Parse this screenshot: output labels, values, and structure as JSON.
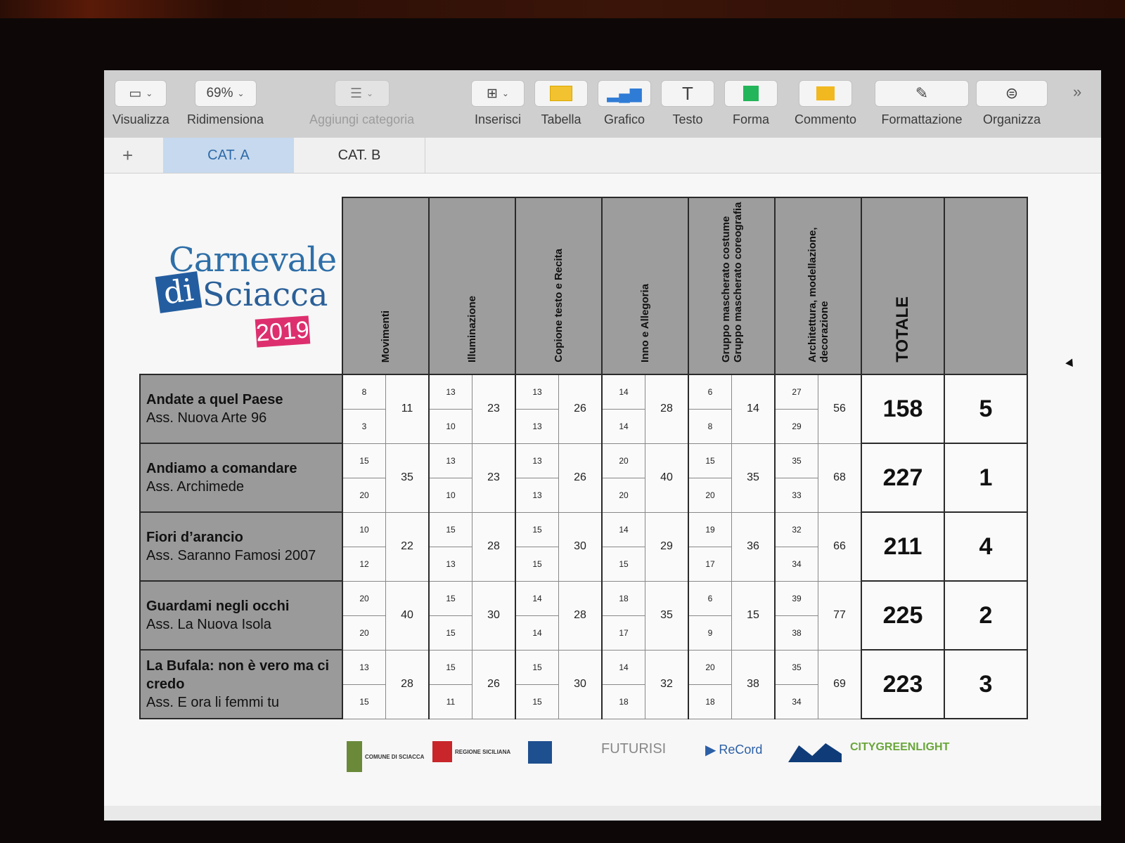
{
  "toolbar": {
    "items": [
      {
        "label": "Visualizza",
        "icon": "sidebar-icon"
      },
      {
        "label": "Ridimensiona",
        "value": "69%"
      },
      {
        "label": "Aggiungi categoria",
        "icon": "list-icon"
      },
      {
        "label": "Inserisci",
        "icon": "insert-icon"
      },
      {
        "label": "Tabella",
        "icon": "table-icon"
      },
      {
        "label": "Grafico",
        "icon": "chart-icon"
      },
      {
        "label": "Testo",
        "icon": "text-icon"
      },
      {
        "label": "Forma",
        "icon": "shape-icon"
      },
      {
        "label": "Commento",
        "icon": "comment-icon"
      },
      {
        "label": "Formattazione",
        "icon": "brush-icon"
      },
      {
        "label": "Organizza",
        "icon": "organize-icon"
      }
    ],
    "more": "»"
  },
  "tabs": {
    "add": "+",
    "items": [
      "CAT. A",
      "CAT. B"
    ]
  },
  "logo": {
    "line1": "Carnevale",
    "di": "di",
    "line2": "Sciacca",
    "year": "2019"
  },
  "table": {
    "headers": [
      "Movimenti",
      "Illuminazione",
      "Copione testo e Recita",
      "Inno e Allegoria",
      "Gruppo mascherato costume Gruppo mascherato coreografia",
      "Architettura, modellazione, decorazione",
      "TOTALE",
      ""
    ],
    "rows": [
      {
        "title": "Andate a quel Paese",
        "assoc": "Ass. Nuova Arte 96",
        "scores": [
          [
            "8",
            "3",
            "11"
          ],
          [
            "13",
            "10",
            "23"
          ],
          [
            "13",
            "13",
            "26"
          ],
          [
            "14",
            "14",
            "28"
          ],
          [
            "6",
            "8",
            "14"
          ],
          [
            "27",
            "29",
            "56"
          ]
        ],
        "total": "158",
        "rank": "5"
      },
      {
        "title": "Andiamo a comandare",
        "assoc": "Ass. Archimede",
        "scores": [
          [
            "15",
            "20",
            "35"
          ],
          [
            "13",
            "10",
            "23"
          ],
          [
            "13",
            "13",
            "26"
          ],
          [
            "20",
            "20",
            "40"
          ],
          [
            "15",
            "20",
            "35"
          ],
          [
            "35",
            "33",
            "68"
          ]
        ],
        "total": "227",
        "rank": "1"
      },
      {
        "title": "Fiori d’arancio",
        "assoc": "Ass. Saranno Famosi 2007",
        "scores": [
          [
            "10",
            "12",
            "22"
          ],
          [
            "15",
            "13",
            "28"
          ],
          [
            "15",
            "15",
            "30"
          ],
          [
            "14",
            "15",
            "29"
          ],
          [
            "19",
            "17",
            "36"
          ],
          [
            "32",
            "34",
            "66"
          ]
        ],
        "total": "211",
        "rank": "4"
      },
      {
        "title": "Guardami negli occhi",
        "assoc": "Ass. La Nuova Isola",
        "scores": [
          [
            "20",
            "20",
            "40"
          ],
          [
            "15",
            "15",
            "30"
          ],
          [
            "14",
            "14",
            "28"
          ],
          [
            "18",
            "17",
            "35"
          ],
          [
            "6",
            "9",
            "15"
          ],
          [
            "39",
            "38",
            "77"
          ]
        ],
        "total": "225",
        "rank": "2"
      },
      {
        "title": "La Bufala: non è vero ma ci credo",
        "assoc": "Ass. E ora li femmi tu",
        "scores": [
          [
            "13",
            "15",
            "28"
          ],
          [
            "15",
            "11",
            "26"
          ],
          [
            "15",
            "15",
            "30"
          ],
          [
            "14",
            "18",
            "32"
          ],
          [
            "20",
            "18",
            "38"
          ],
          [
            "35",
            "34",
            "69"
          ]
        ],
        "total": "223",
        "rank": "3"
      }
    ]
  },
  "sponsors": [
    "COMUNE DI SCIACCA",
    "REGIONE SICILIANA",
    "FUTURISI",
    "ReCord",
    "CITYGREENLIGHT"
  ],
  "colors": {
    "tab_active_bg": "#c6d9ee",
    "tab_active_text": "#2f6aa8",
    "header_gray": "#9d9d9d",
    "logo_blue": "#2e6fa8",
    "logo_pink": "#dd2f6e"
  }
}
